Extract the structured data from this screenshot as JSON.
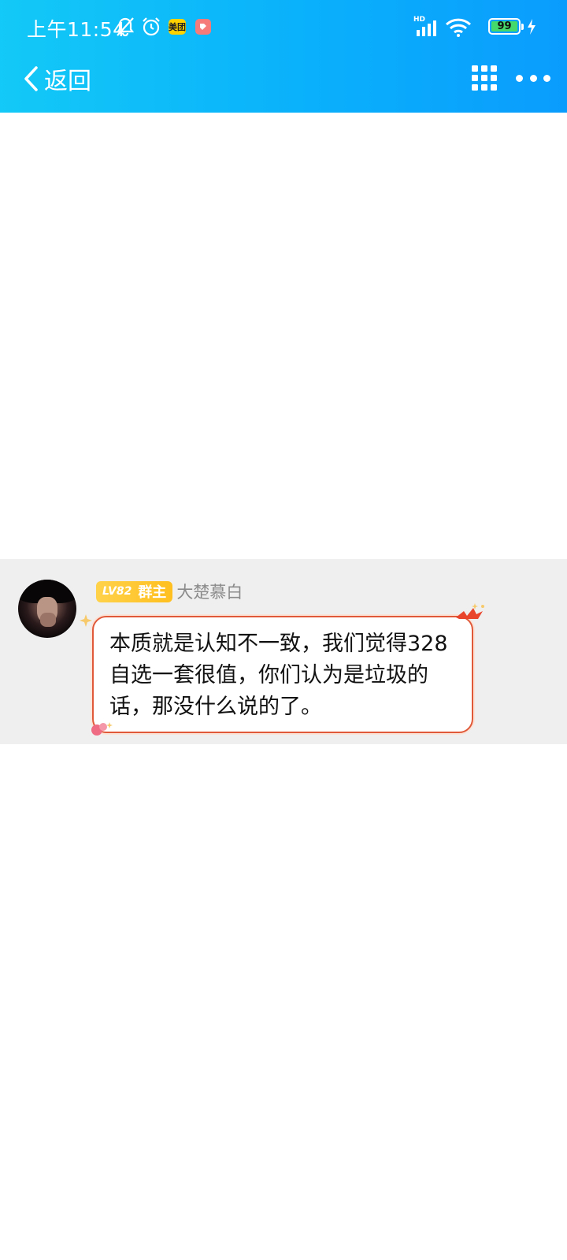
{
  "status_bar": {
    "time": "上午11:54",
    "app_badge_meituan": "美团",
    "network_label": "HD",
    "battery_level": "99",
    "colors": {
      "battery_fill": "#45d86a"
    }
  },
  "nav": {
    "back_label": "返回"
  },
  "header": {
    "gradient_start": "#13c9f7",
    "gradient_end": "#0a9cfd"
  },
  "message": {
    "level_label": "LV82",
    "role_label": "群主",
    "sender_name": "大楚慕白",
    "text": "本质就是认知不一致，我们觉得328自选一套很值，你们认为是垃圾的话，那没什么说的了。",
    "colors": {
      "bubble_border": "#e05a3a",
      "badge": "#ffc62a"
    }
  }
}
